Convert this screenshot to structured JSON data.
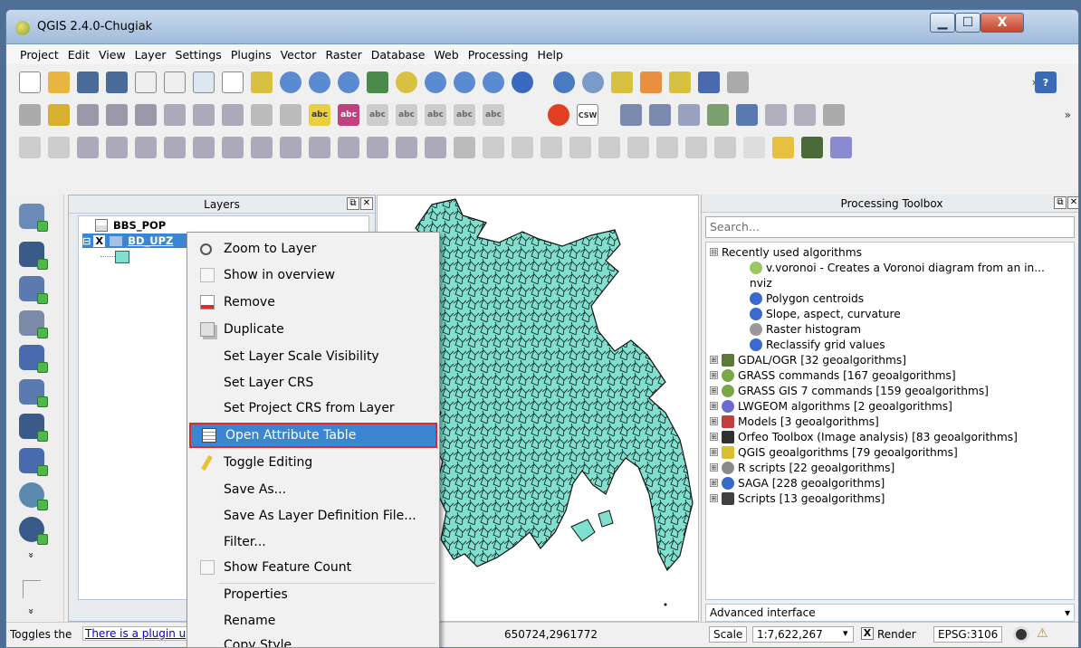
{
  "window": {
    "title": "QGIS 2.4.0-Chugiak",
    "min_glyph": "▁",
    "max_glyph": "☐",
    "close_glyph": "X"
  },
  "menubar": [
    "Project",
    "Edit",
    "View",
    "Layer",
    "Settings",
    "Plugins",
    "Vector",
    "Raster",
    "Database",
    "Web",
    "Processing",
    "Help"
  ],
  "layers_panel": {
    "title": "Layers",
    "float_glyph": "⧉",
    "close_glyph": "✕",
    "layers": [
      {
        "name": "BBS_POP",
        "checked": false
      },
      {
        "name": "BD_UPZ",
        "checked": true
      }
    ],
    "checkbox_glyph": "X",
    "collapse_glyph": "⊟"
  },
  "toolbar_labels": {
    "abc": "abc",
    "csw": "CSW",
    "more": "»",
    "help": "?"
  },
  "vtool_more": "»",
  "context_menu": {
    "items": [
      {
        "label": "Zoom to Layer",
        "icon": "magnifier-icon"
      },
      {
        "label": "Show in overview",
        "icon": "checkbox-icon"
      },
      {
        "label": "Remove",
        "icon": "remove-layer-icon"
      },
      {
        "label": "Duplicate",
        "icon": "duplicate-icon"
      },
      {
        "label": "Set Layer Scale Visibility",
        "icon": ""
      },
      {
        "label": "Set Layer CRS",
        "icon": ""
      },
      {
        "label": "Set Project CRS from Layer",
        "icon": ""
      },
      {
        "label": "Open Attribute Table",
        "icon": "table-icon",
        "selected": true
      },
      {
        "label": "Toggle Editing",
        "icon": "pencil-icon"
      },
      {
        "label": "Save As...",
        "icon": ""
      },
      {
        "label": "Save As Layer Definition File...",
        "icon": ""
      },
      {
        "label": "Filter...",
        "icon": ""
      },
      {
        "label": "Show Feature Count",
        "icon": "checkbox-icon"
      },
      {
        "label": "Properties",
        "icon": ""
      },
      {
        "label": "Rename",
        "icon": ""
      },
      {
        "label": "Copy Style",
        "icon": ""
      }
    ]
  },
  "processing_toolbox": {
    "title": "Processing Toolbox",
    "float_glyph": "⧉",
    "close_glyph": "✕",
    "search_placeholder": "Search...",
    "recent_header": "Recently used algorithms",
    "recent": [
      {
        "label": "v.voronoi - Creates a Voronoi diagram from an in...",
        "icon": "grass-icon"
      },
      {
        "label": "nviz",
        "icon": ""
      },
      {
        "label": "Polygon centroids",
        "icon": "qgis-icon"
      },
      {
        "label": "Slope, aspect, curvature",
        "icon": "qgis-icon"
      },
      {
        "label": "Raster histogram",
        "icon": "r-icon"
      },
      {
        "label": "Reclassify grid values",
        "icon": "qgis-icon"
      }
    ],
    "groups": [
      {
        "label": "GDAL/OGR [32 geoalgorithms]",
        "color": "#5a7a3a"
      },
      {
        "label": "GRASS commands [167 geoalgorithms]",
        "color": "#7aa844"
      },
      {
        "label": "GRASS GIS 7 commands [159 geoalgorithms]",
        "color": "#7aa844"
      },
      {
        "label": "LWGEOM algorithms [2 geoalgorithms]",
        "color": "#6a6ad0"
      },
      {
        "label": "Models [3 geoalgorithms]",
        "color": "#c04040"
      },
      {
        "label": "Orfeo Toolbox (Image analysis) [83 geoalgorithms]",
        "color": "#303030"
      },
      {
        "label": "QGIS geoalgorithms [79 geoalgorithms]",
        "color": "#d8c030"
      },
      {
        "label": "R scripts [22 geoalgorithms]",
        "color": "#8a8a8a"
      },
      {
        "label": "SAGA [228 geoalgorithms]",
        "color": "#3a6ac8"
      },
      {
        "label": "Scripts [13 geoalgorithms]",
        "color": "#404040"
      }
    ],
    "advanced_label": "Advanced interface",
    "advanced_arrow": "▾",
    "expand_glyph": "⊞",
    "collapse_glyph": "⊟"
  },
  "statusbar": {
    "tip": "Toggles the",
    "plugin_link": "There is a plugin up",
    "coords": "650724,2961772",
    "scale_label": "Scale",
    "scale_value": "1:7,622,267",
    "dropdown_glyph": "▾",
    "render_check": "X",
    "render_label": "Render",
    "crs": "EPSG:3106",
    "warning_glyph": "⚠"
  }
}
